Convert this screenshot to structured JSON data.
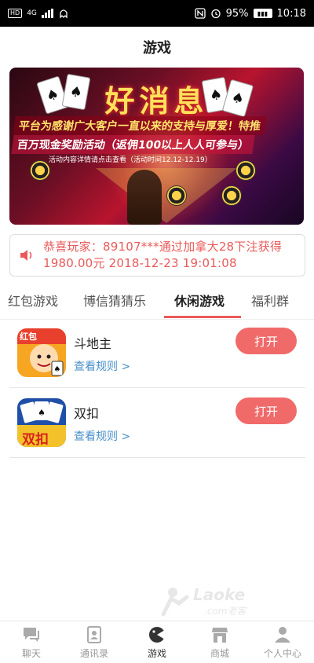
{
  "status_bar": {
    "left_badges": [
      "HD",
      "4G"
    ],
    "battery": "95%",
    "time": "10:18",
    "icons": [
      "nfc-icon",
      "alarm-icon",
      "battery-icon"
    ]
  },
  "header": {
    "title": "游戏"
  },
  "banner": {
    "title": "好消息",
    "line1": "平台为感谢广大客户一直以来的支持与厚爱！特推",
    "line2": "百万现金奖励活动（返佣100以上人人可参与）",
    "note": "活动内容详情请点击查看（活动时间12.12-12.19）"
  },
  "notice": {
    "text": "恭喜玩家：89107***通过加拿大28下注获得1980.00元 2018-12-23 19:01:08",
    "icon": "speaker-icon"
  },
  "tabs": [
    {
      "label": "红包游戏",
      "active": false
    },
    {
      "label": "博信猜猜乐",
      "active": false
    },
    {
      "label": "休闲游戏",
      "active": true
    },
    {
      "label": "福利群",
      "active": false
    }
  ],
  "games": [
    {
      "name": "斗地主",
      "rules": "查看规则 >",
      "button": "打开",
      "icon_badge": "红包"
    },
    {
      "name": "双扣",
      "rules": "查看规则 >",
      "button": "打开",
      "icon_badge": "双扣"
    }
  ],
  "watermark": {
    "text": "Laoke",
    "sub": ".com老客"
  },
  "bottom_nav": [
    {
      "label": "聊天",
      "icon": "chat-icon",
      "active": false
    },
    {
      "label": "通讯录",
      "icon": "contacts-icon",
      "active": false
    },
    {
      "label": "游戏",
      "icon": "game-icon",
      "active": true
    },
    {
      "label": "商城",
      "icon": "shop-icon",
      "active": false
    },
    {
      "label": "个人中心",
      "icon": "profile-icon",
      "active": false
    }
  ],
  "colors": {
    "accent": "#ea5a5a",
    "button": "#f06a6a",
    "link": "#4a90c9"
  }
}
